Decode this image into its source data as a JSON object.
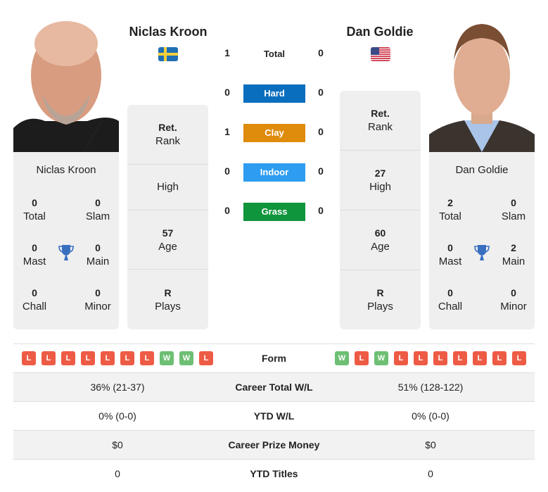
{
  "player1": {
    "name": "Niclas Kroon",
    "country_flag": "sweden-flag",
    "card_name": "Niclas Kroon",
    "titles": {
      "total": "0",
      "total_label": "Total",
      "slam": "0",
      "slam_label": "Slam",
      "mast": "0",
      "mast_label": "Mast",
      "main": "0",
      "main_label": "Main",
      "chall": "0",
      "chall_label": "Chall",
      "minor": "0",
      "minor_label": "Minor"
    },
    "rank": {
      "value": "Ret.",
      "label": "Rank"
    },
    "high": {
      "value": "",
      "label": "High"
    },
    "age": {
      "value": "57",
      "label": "Age"
    },
    "plays": {
      "value": "R",
      "label": "Plays"
    },
    "form": [
      "L",
      "L",
      "L",
      "L",
      "L",
      "L",
      "L",
      "W",
      "W",
      "L"
    ],
    "career_wl": "36% (21-37)",
    "ytd_wl": "0% (0-0)",
    "prize_money": "$0",
    "ytd_titles": "0"
  },
  "player2": {
    "name": "Dan Goldie",
    "country_flag": "usa-flag",
    "card_name": "Dan Goldie",
    "titles": {
      "total": "2",
      "total_label": "Total",
      "slam": "0",
      "slam_label": "Slam",
      "mast": "0",
      "mast_label": "Mast",
      "main": "2",
      "main_label": "Main",
      "chall": "0",
      "chall_label": "Chall",
      "minor": "0",
      "minor_label": "Minor"
    },
    "rank": {
      "value": "Ret.",
      "label": "Rank"
    },
    "high": {
      "value": "27",
      "label": "High"
    },
    "age": {
      "value": "60",
      "label": "Age"
    },
    "plays": {
      "value": "R",
      "label": "Plays"
    },
    "form": [
      "W",
      "L",
      "W",
      "L",
      "L",
      "L",
      "L",
      "L",
      "L",
      "L"
    ],
    "career_wl": "51% (128-122)",
    "ytd_wl": "0% (0-0)",
    "prize_money": "$0",
    "ytd_titles": "0"
  },
  "h2h": {
    "total": {
      "label": "Total",
      "p1": "1",
      "p2": "0"
    },
    "surfaces": [
      {
        "label": "Hard",
        "p1": "0",
        "p2": "0",
        "color": "#0a6ebf"
      },
      {
        "label": "Clay",
        "p1": "1",
        "p2": "0",
        "color": "#df8b0b"
      },
      {
        "label": "Indoor",
        "p1": "0",
        "p2": "0",
        "color": "#2e9cf0"
      },
      {
        "label": "Grass",
        "p1": "0",
        "p2": "0",
        "color": "#0f953b"
      }
    ]
  },
  "table": {
    "form_label": "Form",
    "career_label": "Career Total W/L",
    "ytd_label": "YTD W/L",
    "prize_label": "Career Prize Money",
    "titles_label": "YTD Titles"
  },
  "colors": {
    "win": "#6dbf73",
    "loss": "#ee5b45",
    "trophy": "#3a6fc0"
  }
}
